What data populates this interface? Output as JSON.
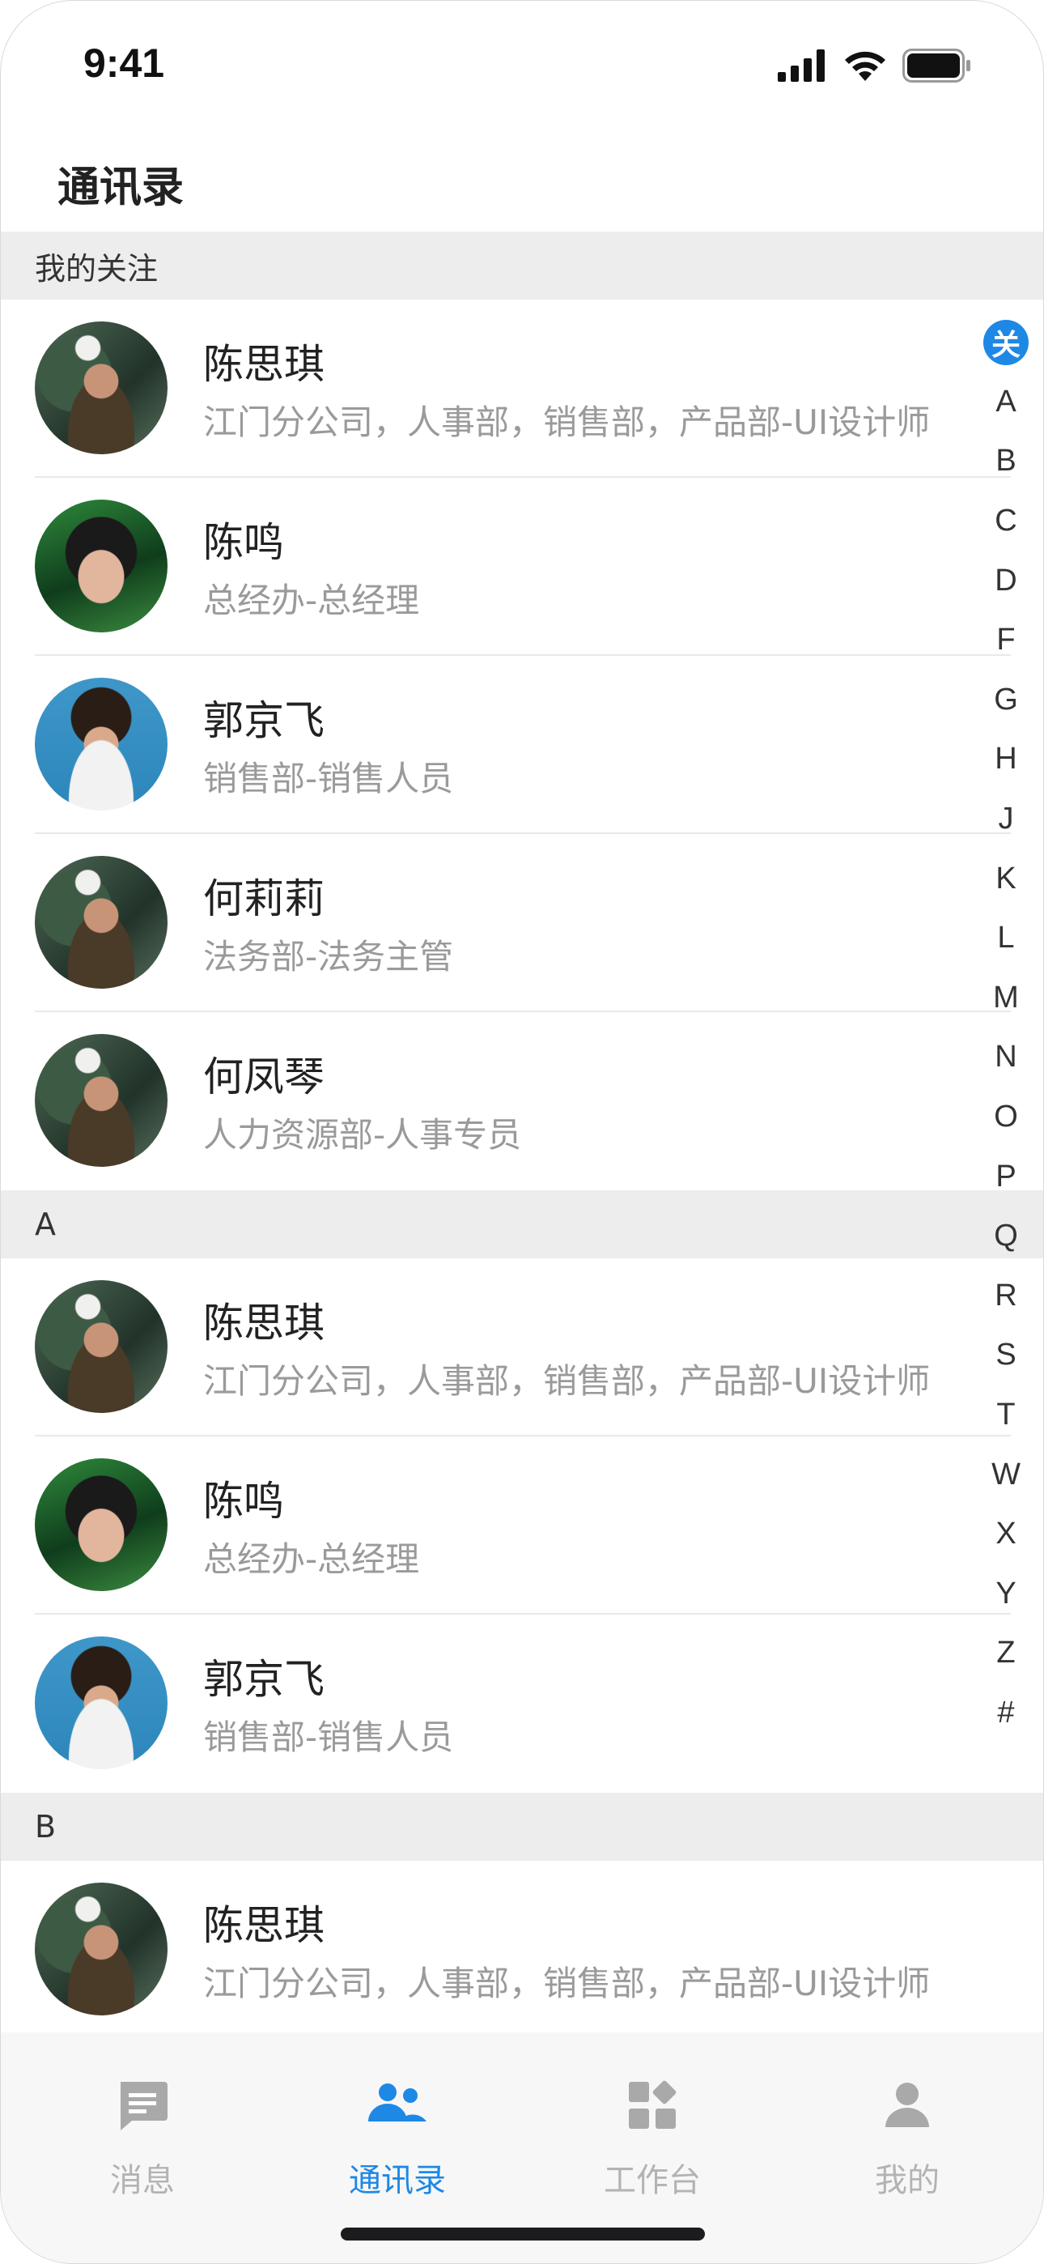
{
  "status_bar": {
    "time": "9:41"
  },
  "header": {
    "title": "通讯录"
  },
  "sections": [
    {
      "title": "我的关注",
      "contacts": [
        {
          "name": "陈思琪",
          "dept": "江门分公司，人事部，销售部，产品部-UI设计师",
          "avatar": "forest"
        },
        {
          "name": "陈鸣",
          "dept": "总经办-总经理",
          "avatar": "leaf"
        },
        {
          "name": "郭京飞",
          "dept": "销售部-销售人员",
          "avatar": "blue"
        },
        {
          "name": "何莉莉",
          "dept": "法务部-法务主管",
          "avatar": "forest"
        },
        {
          "name": "何凤琴",
          "dept": "人力资源部-人事专员",
          "avatar": "forest"
        }
      ]
    },
    {
      "title": "A",
      "contacts": [
        {
          "name": "陈思琪",
          "dept": "江门分公司，人事部，销售部，产品部-UI设计师",
          "avatar": "forest"
        },
        {
          "name": "陈鸣",
          "dept": "总经办-总经理",
          "avatar": "leaf"
        },
        {
          "name": "郭京飞",
          "dept": "销售部-销售人员",
          "avatar": "blue"
        }
      ]
    },
    {
      "title": "B",
      "contacts": [
        {
          "name": "陈思琪",
          "dept": "江门分公司，人事部，销售部，产品部-UI设计师",
          "avatar": "forest"
        }
      ]
    }
  ],
  "index_bar": {
    "active": "关",
    "letters": [
      "A",
      "B",
      "C",
      "D",
      "F",
      "G",
      "H",
      "J",
      "K",
      "L",
      "M",
      "N",
      "O",
      "P",
      "Q",
      "R",
      "S",
      "T",
      "W",
      "X",
      "Y",
      "Z",
      "#"
    ]
  },
  "tab_bar": {
    "tabs": [
      {
        "label": "消息",
        "icon": "message-icon",
        "active": false
      },
      {
        "label": "通讯录",
        "icon": "contacts-icon",
        "active": true
      },
      {
        "label": "工作台",
        "icon": "workbench-icon",
        "active": false
      },
      {
        "label": "我的",
        "icon": "profile-icon",
        "active": false
      }
    ]
  },
  "colors": {
    "accent": "#1e88e5",
    "section_bg": "#ededed",
    "muted_text": "#9a9a9a"
  }
}
